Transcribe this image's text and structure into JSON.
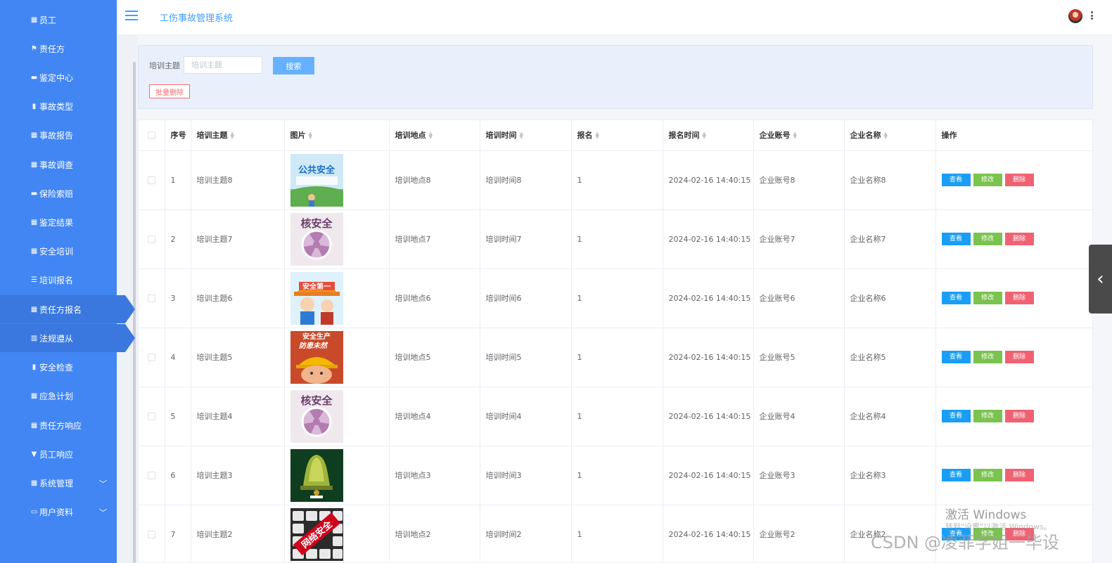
{
  "header": {
    "title": "工伤事故管理系统"
  },
  "sidebar": {
    "items": [
      {
        "label": "员工",
        "icon": "grid-icon",
        "glyph": "▦",
        "active": false,
        "caret": false
      },
      {
        "label": "责任方",
        "icon": "flag-icon",
        "glyph": "⚑",
        "active": false,
        "caret": false
      },
      {
        "label": "鉴定中心",
        "icon": "briefcase-icon",
        "glyph": "▬",
        "active": false,
        "caret": false
      },
      {
        "label": "事故类型",
        "icon": "clipboard-icon",
        "glyph": "▮",
        "active": false,
        "caret": false
      },
      {
        "label": "事故报告",
        "icon": "grid-icon",
        "glyph": "▦",
        "active": false,
        "caret": false
      },
      {
        "label": "事故调查",
        "icon": "grid-icon",
        "glyph": "▦",
        "active": false,
        "caret": false
      },
      {
        "label": "保险索赔",
        "icon": "ticket-icon",
        "glyph": "▬",
        "active": false,
        "caret": false
      },
      {
        "label": "鉴定结果",
        "icon": "grid-icon",
        "glyph": "▦",
        "active": false,
        "caret": false
      },
      {
        "label": "安全培训",
        "icon": "grid-icon",
        "glyph": "▦",
        "active": false,
        "caret": false
      },
      {
        "label": "培训报名",
        "icon": "sliders-icon",
        "glyph": "☰",
        "active": false,
        "caret": false
      },
      {
        "label": "责任方报名",
        "icon": "grid-icon",
        "glyph": "▦",
        "active": true,
        "caret": false
      },
      {
        "label": "法规遵从",
        "icon": "bar-chart-icon",
        "glyph": "▥",
        "active": true,
        "caret": false
      },
      {
        "label": "安全检查",
        "icon": "book-icon",
        "glyph": "▮",
        "active": false,
        "caret": false
      },
      {
        "label": "应急计划",
        "icon": "grid-icon",
        "glyph": "▦",
        "active": false,
        "caret": false
      },
      {
        "label": "责任方响应",
        "icon": "grid-icon",
        "glyph": "▦",
        "active": false,
        "caret": false
      },
      {
        "label": "员工响应",
        "icon": "badge-icon",
        "glyph": "▼",
        "active": false,
        "caret": false
      },
      {
        "label": "系统管理",
        "icon": "grid-icon",
        "glyph": "▦",
        "active": false,
        "caret": true
      },
      {
        "label": "用户资料",
        "icon": "id-card-icon",
        "glyph": "▭",
        "active": false,
        "caret": true
      }
    ]
  },
  "search": {
    "label": "培训主题",
    "placeholder": "培训主题",
    "value": "",
    "button": "搜索",
    "batch_delete": "批量删除"
  },
  "table": {
    "columns": [
      {
        "key": "cb",
        "label": "",
        "sortable": false
      },
      {
        "key": "index",
        "label": "序号",
        "sortable": false
      },
      {
        "key": "topic",
        "label": "培训主题",
        "sortable": true
      },
      {
        "key": "image",
        "label": "图片",
        "sortable": true
      },
      {
        "key": "location",
        "label": "培训地点",
        "sortable": true
      },
      {
        "key": "time",
        "label": "培训时间",
        "sortable": true
      },
      {
        "key": "signup",
        "label": "报名",
        "sortable": true
      },
      {
        "key": "signup_time",
        "label": "报名时间",
        "sortable": true
      },
      {
        "key": "account",
        "label": "企业账号",
        "sortable": true
      },
      {
        "key": "company",
        "label": "企业名称",
        "sortable": true
      },
      {
        "key": "ops",
        "label": "操作",
        "sortable": false
      }
    ],
    "actions": {
      "view": "查看",
      "edit": "修改",
      "delete": "删除"
    },
    "rows": [
      {
        "index": "1",
        "topic": "培训主题8",
        "image_text": "公共安全",
        "image_icon": "public-safety-image",
        "location": "培训地点8",
        "time": "培训时间8",
        "signup": "1",
        "signup_time": "2024-02-16 14:40:15",
        "account": "企业账号8",
        "company": "企业名称8"
      },
      {
        "index": "2",
        "topic": "培训主题7",
        "image_text": "核安全",
        "image_icon": "nuclear-safety-image",
        "location": "培训地点7",
        "time": "培训时间7",
        "signup": "1",
        "signup_time": "2024-02-16 14:40:15",
        "account": "企业账号7",
        "company": "企业名称7"
      },
      {
        "index": "3",
        "topic": "培训主题6",
        "image_text": "安全第一",
        "image_icon": "safety-first-image",
        "location": "培训地点6",
        "time": "培训时间6",
        "signup": "1",
        "signup_time": "2024-02-16 14:40:15",
        "account": "企业账号6",
        "company": "企业名称6"
      },
      {
        "index": "4",
        "topic": "培训主题5",
        "image_text": "安全生产",
        "image_sub": "防患未然",
        "image_icon": "production-safety-image",
        "location": "培训地点5",
        "time": "培训时间5",
        "signup": "1",
        "signup_time": "2024-02-16 14:40:15",
        "account": "企业账号5",
        "company": "企业名称5"
      },
      {
        "index": "5",
        "topic": "培训主题4",
        "image_text": "核安全",
        "image_icon": "nuclear-safety-image",
        "location": "培训地点4",
        "time": "培训时间4",
        "signup": "1",
        "signup_time": "2024-02-16 14:40:15",
        "account": "企业账号4",
        "company": "企业名称4"
      },
      {
        "index": "6",
        "topic": "培训主题3",
        "image_text": "",
        "image_icon": "bell-image",
        "location": "培训地点3",
        "time": "培训时间3",
        "signup": "1",
        "signup_time": "2024-02-16 14:40:15",
        "account": "企业账号3",
        "company": "企业名称3"
      },
      {
        "index": "7",
        "topic": "培训主题2",
        "image_text": "网络安全",
        "image_icon": "network-safety-image",
        "location": "培训地点2",
        "time": "培训时间2",
        "signup": "1",
        "signup_time": "2024-02-16 14:40:15",
        "account": "企业账号2",
        "company": "企业名称2"
      }
    ]
  },
  "overlay": {
    "activate_title": "激活 Windows",
    "activate_sub": "转到\"设置\"以激活 Windows。",
    "watermark": "CSDN @凌菲学姐一毕设"
  },
  "colors": {
    "sidebar": "#4286f4",
    "accent": "#409eff",
    "view_btn": "#1a9ef5",
    "edit_btn": "#7ac34e",
    "delete_btn": "#f06272"
  }
}
